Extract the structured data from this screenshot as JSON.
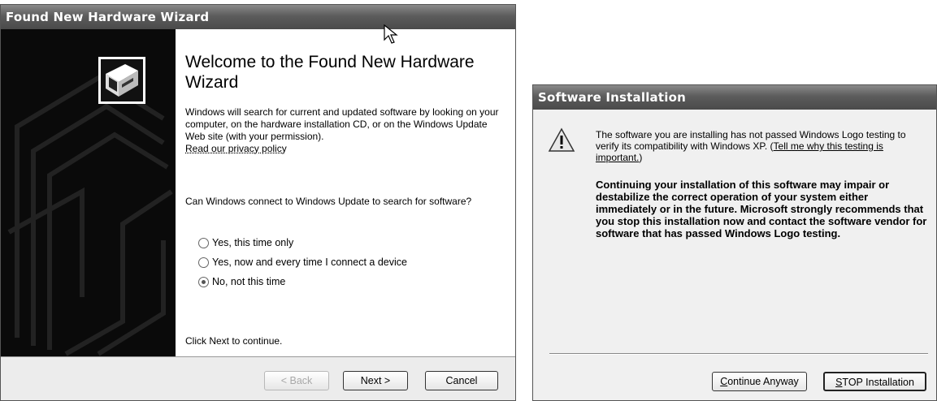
{
  "wizard": {
    "title": "Found New Hardware Wizard",
    "heading": "Welcome to the Found New Hardware Wizard",
    "intro": "Windows will search for current and updated software by looking on your computer, on the hardware installation CD, or on the Windows Update Web site (with your permission).",
    "privacy_link": "Read our privacy policy",
    "question": "Can Windows connect to Windows Update to search for software?",
    "options": [
      {
        "label": "Yes, this time only",
        "selected": false
      },
      {
        "label": "Yes, now and every time I connect a device",
        "selected": false
      },
      {
        "label": "No, not this time",
        "selected": true
      }
    ],
    "continue_text": "Click Next to continue.",
    "buttons": {
      "back": "< Back",
      "next": "Next >",
      "cancel": "Cancel"
    }
  },
  "install": {
    "title": "Software Installation",
    "message_part1": "The software you are installing has not passed Windows Logo testing to verify its compatibility with Windows XP. (",
    "why_link": "Tell me why this testing is important.",
    "message_part2": ")",
    "warning_text": "Continuing your installation of this software may impair or destabilize the correct operation of your system either immediately or in the future. Microsoft strongly recommends that you stop this installation now and contact the software vendor for software that has passed Windows Logo testing.",
    "buttons": {
      "continue_accel": "C",
      "continue_rest": "ontinue Anyway",
      "stop_accel": "S",
      "stop_rest": "TOP Installation"
    }
  }
}
